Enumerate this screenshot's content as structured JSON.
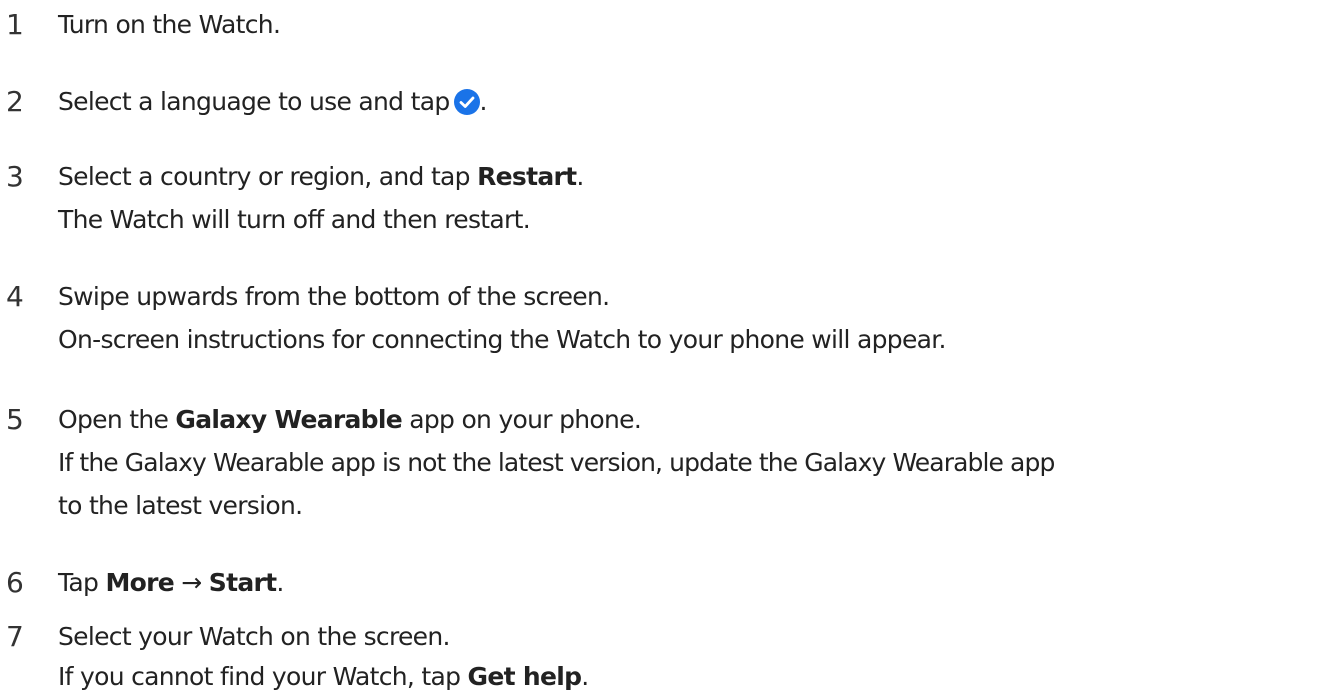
{
  "steps": [
    {
      "number": "1",
      "lines": [
        {
          "text": "Turn on the Watch."
        }
      ]
    },
    {
      "number": "2",
      "lines": [
        {
          "before": "Select a language to use and tap",
          "icon": "check-circle-icon",
          "after": "."
        }
      ]
    },
    {
      "number": "3",
      "lines": [
        {
          "before": "Select a country or region, and tap ",
          "bold": "Restart",
          "after": "."
        },
        {
          "text": "The Watch will turn off and then restart."
        }
      ]
    },
    {
      "number": "4",
      "lines": [
        {
          "text": "Swipe upwards from the bottom of the screen."
        },
        {
          "text": "On-screen instructions for connecting the Watch to your phone will appear."
        }
      ]
    },
    {
      "number": "5",
      "lines": [
        {
          "before": "Open the ",
          "bold": "Galaxy Wearable",
          "after": " app on your phone."
        },
        {
          "text": "If the Galaxy Wearable app is not the latest version, update the Galaxy Wearable app"
        },
        {
          "text": "to the latest version."
        }
      ]
    },
    {
      "number": "6",
      "lines": [
        {
          "before": "Tap ",
          "bold": "More",
          "mid": " → ",
          "bold2": "Start",
          "after": "."
        }
      ]
    },
    {
      "number": "7",
      "lines": [
        {
          "text": "Select your Watch on the screen."
        },
        {
          "before": "If you cannot find your Watch, tap ",
          "bold": "Get help",
          "after": "."
        }
      ]
    }
  ],
  "colors": {
    "text": "#222222",
    "accent": "#1a73e8"
  }
}
